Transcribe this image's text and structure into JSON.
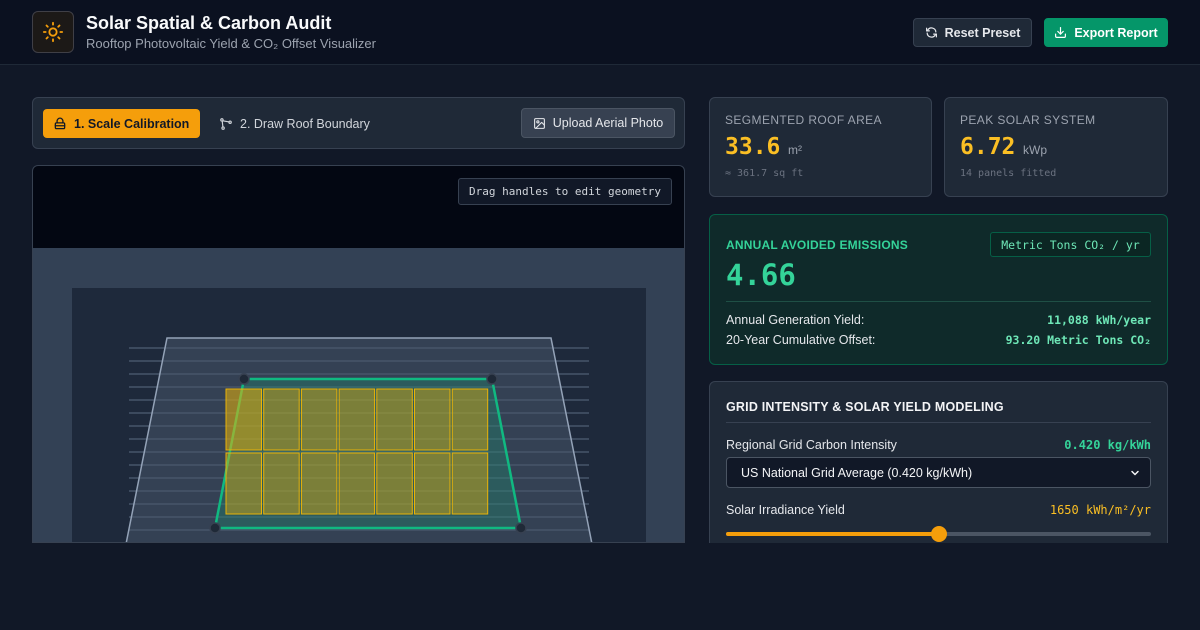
{
  "header": {
    "title": "Solar Spatial & Carbon Audit",
    "subtitle": "Rooftop Photovoltaic Yield & CO₂ Offset Visualizer",
    "logo_icon": "sun-icon",
    "reset_label": "Reset Preset",
    "export_label": "Export Report"
  },
  "toolbar": {
    "step1_label": "1. Scale Calibration",
    "step2_label": "2. Draw Roof Boundary",
    "upload_label": "Upload Aerial Photo",
    "active_step": 1
  },
  "canvas": {
    "hint": "Drag handles to edit geometry",
    "panel_rows": 2,
    "panel_cols": 7,
    "panel_color": "#eab308",
    "boundary_color": "#10b981"
  },
  "stats": {
    "area": {
      "label": "SEGMENTED ROOF AREA",
      "value": "33.6",
      "unit": "m²",
      "foot": "≈ 361.7 sq ft"
    },
    "peak": {
      "label": "PEAK SOLAR SYSTEM",
      "value": "6.72",
      "unit": "kWp",
      "foot": "14 panels fitted"
    }
  },
  "emissions": {
    "label": "ANNUAL AVOIDED EMISSIONS",
    "badge": "Metric Tons CO₂ / yr",
    "value": "4.66",
    "rows": [
      {
        "label": "Annual Generation Yield:",
        "value": "11,088 kWh/year"
      },
      {
        "label": "20-Year Cumulative Offset:",
        "value": "93.20 Metric Tons CO₂"
      }
    ]
  },
  "grid": {
    "title": "GRID INTENSITY & SOLAR YIELD MODELING",
    "intensity_label": "Regional Grid Carbon Intensity",
    "intensity_value": "0.420 kg/kWh",
    "select_value": "US National Grid Average (0.420 kg/kWh)",
    "irradiance_label": "Solar Irradiance Yield",
    "irradiance_value": "1650 kWh/m²/yr",
    "irradiance_fraction": 0.5
  },
  "colors": {
    "accent": "#f59e0b",
    "success": "#10b981",
    "background": "#111827"
  }
}
